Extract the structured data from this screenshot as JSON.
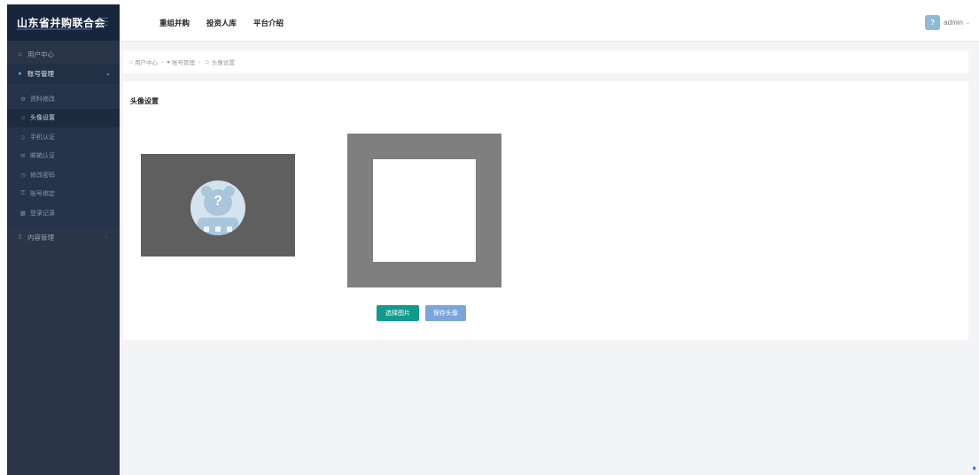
{
  "brand": {
    "title": "山东省并购联合会"
  },
  "topbar": {
    "links": [
      "重组并购",
      "投资人库",
      "平台介绍"
    ],
    "user": {
      "name": "admin",
      "avatar_glyph": "?"
    }
  },
  "sidebar": {
    "user_center": "用户中心",
    "account_mgmt": "账号管理",
    "account_items": [
      "资料修改",
      "头像设置",
      "手机认证",
      "邮箱认证",
      "修改密码",
      "账号绑定",
      "登录记录"
    ],
    "content_mgmt": "内容管理"
  },
  "breadcrumb": {
    "home": "用户中心",
    "account": "账号管理",
    "current": "头像设置"
  },
  "card": {
    "title": "头像设置",
    "select_button": "选择图片",
    "save_button": "保存头像",
    "placeholder_glyph": "?"
  },
  "colors": {
    "sidebar_bg": "#2a3548",
    "brand_bg": "#17263d",
    "select_button": "#139a8c",
    "save_button": "#7ba6dc"
  },
  "icons": [
    "menu-icon",
    "home-icon",
    "user-icon",
    "gear-icon",
    "smile-icon",
    "phone-icon",
    "mail-icon",
    "clock-icon",
    "lock-icon",
    "calendar-icon",
    "grid-icon",
    "chevron-down-icon",
    "chevron-left-icon"
  ]
}
